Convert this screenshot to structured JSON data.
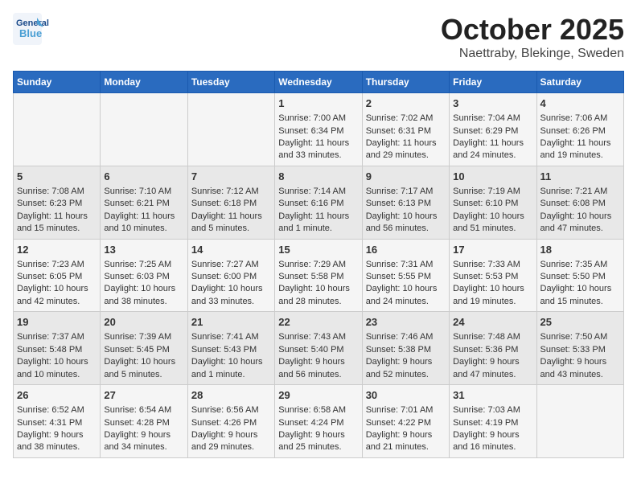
{
  "logo": {
    "line1": "General",
    "line2": "Blue"
  },
  "title": "October 2025",
  "location": "Naettraby, Blekinge, Sweden",
  "days_of_week": [
    "Sunday",
    "Monday",
    "Tuesday",
    "Wednesday",
    "Thursday",
    "Friday",
    "Saturday"
  ],
  "weeks": [
    [
      {
        "day": "",
        "info": ""
      },
      {
        "day": "",
        "info": ""
      },
      {
        "day": "",
        "info": ""
      },
      {
        "day": "1",
        "info": "Sunrise: 7:00 AM\nSunset: 6:34 PM\nDaylight: 11 hours\nand 33 minutes."
      },
      {
        "day": "2",
        "info": "Sunrise: 7:02 AM\nSunset: 6:31 PM\nDaylight: 11 hours\nand 29 minutes."
      },
      {
        "day": "3",
        "info": "Sunrise: 7:04 AM\nSunset: 6:29 PM\nDaylight: 11 hours\nand 24 minutes."
      },
      {
        "day": "4",
        "info": "Sunrise: 7:06 AM\nSunset: 6:26 PM\nDaylight: 11 hours\nand 19 minutes."
      }
    ],
    [
      {
        "day": "5",
        "info": "Sunrise: 7:08 AM\nSunset: 6:23 PM\nDaylight: 11 hours\nand 15 minutes."
      },
      {
        "day": "6",
        "info": "Sunrise: 7:10 AM\nSunset: 6:21 PM\nDaylight: 11 hours\nand 10 minutes."
      },
      {
        "day": "7",
        "info": "Sunrise: 7:12 AM\nSunset: 6:18 PM\nDaylight: 11 hours\nand 5 minutes."
      },
      {
        "day": "8",
        "info": "Sunrise: 7:14 AM\nSunset: 6:16 PM\nDaylight: 11 hours\nand 1 minute."
      },
      {
        "day": "9",
        "info": "Sunrise: 7:17 AM\nSunset: 6:13 PM\nDaylight: 10 hours\nand 56 minutes."
      },
      {
        "day": "10",
        "info": "Sunrise: 7:19 AM\nSunset: 6:10 PM\nDaylight: 10 hours\nand 51 minutes."
      },
      {
        "day": "11",
        "info": "Sunrise: 7:21 AM\nSunset: 6:08 PM\nDaylight: 10 hours\nand 47 minutes."
      }
    ],
    [
      {
        "day": "12",
        "info": "Sunrise: 7:23 AM\nSunset: 6:05 PM\nDaylight: 10 hours\nand 42 minutes."
      },
      {
        "day": "13",
        "info": "Sunrise: 7:25 AM\nSunset: 6:03 PM\nDaylight: 10 hours\nand 38 minutes."
      },
      {
        "day": "14",
        "info": "Sunrise: 7:27 AM\nSunset: 6:00 PM\nDaylight: 10 hours\nand 33 minutes."
      },
      {
        "day": "15",
        "info": "Sunrise: 7:29 AM\nSunset: 5:58 PM\nDaylight: 10 hours\nand 28 minutes."
      },
      {
        "day": "16",
        "info": "Sunrise: 7:31 AM\nSunset: 5:55 PM\nDaylight: 10 hours\nand 24 minutes."
      },
      {
        "day": "17",
        "info": "Sunrise: 7:33 AM\nSunset: 5:53 PM\nDaylight: 10 hours\nand 19 minutes."
      },
      {
        "day": "18",
        "info": "Sunrise: 7:35 AM\nSunset: 5:50 PM\nDaylight: 10 hours\nand 15 minutes."
      }
    ],
    [
      {
        "day": "19",
        "info": "Sunrise: 7:37 AM\nSunset: 5:48 PM\nDaylight: 10 hours\nand 10 minutes."
      },
      {
        "day": "20",
        "info": "Sunrise: 7:39 AM\nSunset: 5:45 PM\nDaylight: 10 hours\nand 5 minutes."
      },
      {
        "day": "21",
        "info": "Sunrise: 7:41 AM\nSunset: 5:43 PM\nDaylight: 10 hours\nand 1 minute."
      },
      {
        "day": "22",
        "info": "Sunrise: 7:43 AM\nSunset: 5:40 PM\nDaylight: 9 hours\nand 56 minutes."
      },
      {
        "day": "23",
        "info": "Sunrise: 7:46 AM\nSunset: 5:38 PM\nDaylight: 9 hours\nand 52 minutes."
      },
      {
        "day": "24",
        "info": "Sunrise: 7:48 AM\nSunset: 5:36 PM\nDaylight: 9 hours\nand 47 minutes."
      },
      {
        "day": "25",
        "info": "Sunrise: 7:50 AM\nSunset: 5:33 PM\nDaylight: 9 hours\nand 43 minutes."
      }
    ],
    [
      {
        "day": "26",
        "info": "Sunrise: 6:52 AM\nSunset: 4:31 PM\nDaylight: 9 hours\nand 38 minutes."
      },
      {
        "day": "27",
        "info": "Sunrise: 6:54 AM\nSunset: 4:28 PM\nDaylight: 9 hours\nand 34 minutes."
      },
      {
        "day": "28",
        "info": "Sunrise: 6:56 AM\nSunset: 4:26 PM\nDaylight: 9 hours\nand 29 minutes."
      },
      {
        "day": "29",
        "info": "Sunrise: 6:58 AM\nSunset: 4:24 PM\nDaylight: 9 hours\nand 25 minutes."
      },
      {
        "day": "30",
        "info": "Sunrise: 7:01 AM\nSunset: 4:22 PM\nDaylight: 9 hours\nand 21 minutes."
      },
      {
        "day": "31",
        "info": "Sunrise: 7:03 AM\nSunset: 4:19 PM\nDaylight: 9 hours\nand 16 minutes."
      },
      {
        "day": "",
        "info": ""
      }
    ]
  ]
}
